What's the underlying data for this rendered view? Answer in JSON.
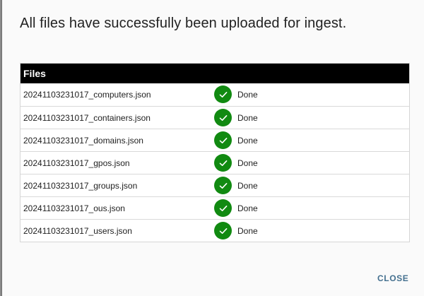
{
  "dialog": {
    "title": "All files have successfully been uploaded for ingest.",
    "close_label": "CLOSE",
    "accent_color": "#44708f",
    "success_color": "#118a11"
  },
  "table": {
    "header": "Files",
    "rows": [
      {
        "file": "20241103231017_computers.json",
        "status": "Done",
        "icon": "check-circle-icon"
      },
      {
        "file": "20241103231017_containers.json",
        "status": "Done",
        "icon": "check-circle-icon"
      },
      {
        "file": "20241103231017_domains.json",
        "status": "Done",
        "icon": "check-circle-icon"
      },
      {
        "file": "20241103231017_gpos.json",
        "status": "Done",
        "icon": "check-circle-icon"
      },
      {
        "file": "20241103231017_groups.json",
        "status": "Done",
        "icon": "check-circle-icon"
      },
      {
        "file": "20241103231017_ous.json",
        "status": "Done",
        "icon": "check-circle-icon"
      },
      {
        "file": "20241103231017_users.json",
        "status": "Done",
        "icon": "check-circle-icon"
      }
    ]
  }
}
